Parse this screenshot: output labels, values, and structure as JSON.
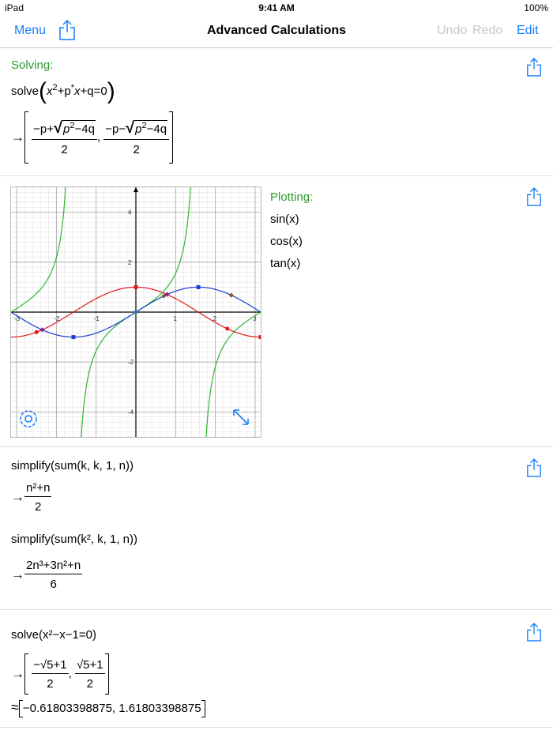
{
  "status": {
    "device": "iPad",
    "time": "9:41 AM",
    "battery": "100%"
  },
  "nav": {
    "menu": "Menu",
    "title": "Advanced Calculations",
    "undo": "Undo",
    "redo": "Redo",
    "edit": "Edit"
  },
  "cell1": {
    "label": "Solving:",
    "fn": "solve",
    "x": "x",
    "exp": "2",
    "rest1": "+p",
    "star": "*",
    "x2": "x",
    "rest2": "+q=0",
    "r1_num_a": "−p+",
    "r1_num_p": "p",
    "r1_num_exp": "2",
    "r1_num_b": "−4q",
    "den": "2",
    "r2_num_a": "−p−",
    "r2_num_p": "p",
    "r2_num_exp": "2",
    "r2_num_b": "−4q",
    "comma": ","
  },
  "cell2": {
    "label": "Plotting:",
    "f1": "sin(x)",
    "f2": "cos(x)",
    "f3": "tan(x)",
    "ticks_x": [
      "-3",
      "-2",
      "-1",
      "1",
      "2",
      "3"
    ],
    "ticks_y": [
      "4",
      "2",
      "-2",
      "-4"
    ]
  },
  "cell3": {
    "line1": "simplify(sum(k, k, 1, n))",
    "res1_num": "n²+n",
    "res1_den": "2",
    "line2": "simplify(sum(k², k, 1, n))",
    "res2_num": "2n³+3n²+n",
    "res2_den": "6"
  },
  "cell4": {
    "line1": "solve(x²−x−1=0)",
    "r1_num": "−√5+1",
    "r1_den": "2",
    "r2_num": "√5+1",
    "r2_den": "2",
    "approx": "≈",
    "approx_vals": "−0.61803398875, 1.61803398875"
  },
  "colors": {
    "accent": "#157efb",
    "green_label": "#2e9b2e",
    "sin": "#1a3fd1",
    "cos": "#e21b1b",
    "tan": "#2fb52f"
  },
  "chart_data": {
    "type": "line",
    "xlim": [
      -3.14,
      3.14
    ],
    "ylim": [
      -5,
      5
    ],
    "series": [
      {
        "name": "sin(x)",
        "color": "#1a3fd1"
      },
      {
        "name": "cos(x)",
        "color": "#e21b1b"
      },
      {
        "name": "tan(x)",
        "color": "#2fb52f"
      }
    ]
  }
}
